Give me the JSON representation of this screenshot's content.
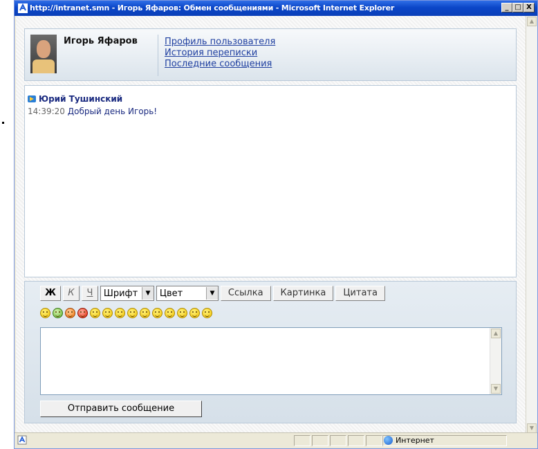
{
  "window": {
    "title": "http://intranet.smn - Игорь Яфаров: Обмен сообщениями - Microsoft Internet Explorer",
    "min_label": "_",
    "max_label": "□",
    "close_label": "X"
  },
  "header": {
    "user_name": "Игорь Яфаров",
    "links": [
      "Профиль пользователя",
      "История переписки",
      "Последние сообщения"
    ]
  },
  "messages": [
    {
      "author": "Юрий Тушинский",
      "time": "14:39:20",
      "text": "Добрый день Игорь!"
    }
  ],
  "toolbar": {
    "bold": "Ж",
    "italic": "К",
    "underline": "Ч",
    "font_select": "Шрифт",
    "color_select": "Цвет",
    "link": "Ссылка",
    "image": "Картинка",
    "quote": "Цитата"
  },
  "smileys": [
    "smile",
    "light-bulb",
    "question",
    "exclamation",
    "smile",
    "angry",
    "sad",
    "confused",
    "surprised",
    "cool",
    "shocked",
    "sad",
    "smile",
    "neutral"
  ],
  "compose": {
    "message_value": "",
    "send_label": "Отправить сообщение"
  },
  "statusbar": {
    "zone": "Интернет"
  }
}
